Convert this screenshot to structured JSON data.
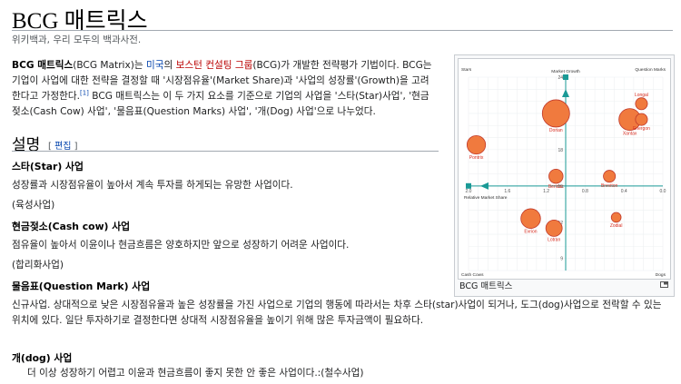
{
  "page": {
    "title": "BCG 매트릭스",
    "tagline": "위키백과, 우리 모두의 백과사전."
  },
  "intro": {
    "bold": "BCG 매트릭스",
    "s1": "(BCG Matrix)는 ",
    "link_us": "미국",
    "s2": "의 ",
    "link_bcg": "보스턴 컨설팅 그룹",
    "s3": "(BCG)가 개발한 전략평가 기법이다. BCG는 기업이 사업에 대한 전략을 결정할 때 '시장점유율'(Market Share)과 '사업의 성장률'(Growth)을 고려한다고 가정한다.",
    "ref": "[1]",
    "s4": " BCG 매트릭스는 이 두 가지 요소를 기준으로 기업의 사업을 '스타(Star)사업', '현금젖소(Cash Cow) 사업', '물음표(Question Marks) 사업', '개(Dog) 사업'으로 나누었다."
  },
  "section": {
    "heading": "설명",
    "edit_open": "[ ",
    "edit": "편집",
    "edit_close": " ]"
  },
  "star": {
    "heading": "스타(Star) 사업",
    "text": "성장률과 시장점유율이 높아서 계속 투자를 하게되는 유망한 사업이다.",
    "note": "(육성사업)"
  },
  "cow": {
    "heading": "현금젖소(Cash cow) 사업",
    "text": "점유율이 높아서 이윤이나 현금흐름은 양호하지만 앞으로 성장하기 어려운 사업이다.",
    "note": "(합리화사업)"
  },
  "question": {
    "heading": "물음표(Question Mark) 사업",
    "text": "신규사업. 상대적으로 낮은 시장점유율과 높은 성장률을 가진 사업으로 기업의 행동에 따라서는 차후 스타(star)사업이 되거나, 도그(dog)사업으로 전락할 수 있는 위치에 있다. 일단 투자하기로 결정한다면 상대적 시장점유율을 높이기 위해 많은 투자금액이 필요하다."
  },
  "dog": {
    "heading": "개(dog) 사업",
    "text": "더 이상 성장하기 어렵고 이윤과 현금흐름이 좋지 못한 안 좋은 사업이다.:(철수사업)"
  },
  "figure": {
    "caption": "BCG 매트릭스",
    "colors": {
      "bubble": "#f07a3e",
      "bubble_edge": "#c0392b",
      "axis": "#1a9a96",
      "label": "#d62d20"
    },
    "icon": "enlarge-icon"
  },
  "chart_data": {
    "type": "scatter",
    "quadrants": [
      "Stars",
      "Question Marks",
      "Cash Cows",
      "Dogs"
    ],
    "xlabel": "Relative Market Share",
    "ylabel": "Market Growth",
    "xticks": [
      "2.0",
      "1.6",
      "1.2",
      "0.8",
      "0.4",
      "0.0"
    ],
    "yticks": [
      "24",
      "21",
      "18",
      "15",
      "12",
      "9"
    ],
    "xlim": [
      2.0,
      0.0
    ],
    "ylim": [
      8,
      24
    ],
    "points": [
      {
        "name": "Dorian",
        "x": 1.1,
        "y": 21.0,
        "r": 2.5
      },
      {
        "name": "Xantax",
        "x": 0.34,
        "y": 20.5,
        "r": 2.0
      },
      {
        "name": "Longal",
        "x": 0.22,
        "y": 21.8,
        "r": 1.1
      },
      {
        "name": "Energon",
        "x": 0.22,
        "y": 20.5,
        "r": 1.1
      },
      {
        "name": "Pontrix",
        "x": 1.92,
        "y": 18.4,
        "r": 1.7
      },
      {
        "name": "Beridac",
        "x": 1.1,
        "y": 15.8,
        "r": 1.3
      },
      {
        "name": "Breviton",
        "x": 0.55,
        "y": 15.8,
        "r": 1.1
      },
      {
        "name": "Evrion",
        "x": 1.36,
        "y": 12.3,
        "r": 1.8
      },
      {
        "name": "Lotran",
        "x": 1.12,
        "y": 11.5,
        "r": 1.5
      },
      {
        "name": "Zodial",
        "x": 0.48,
        "y": 12.4,
        "r": 0.9
      }
    ]
  }
}
